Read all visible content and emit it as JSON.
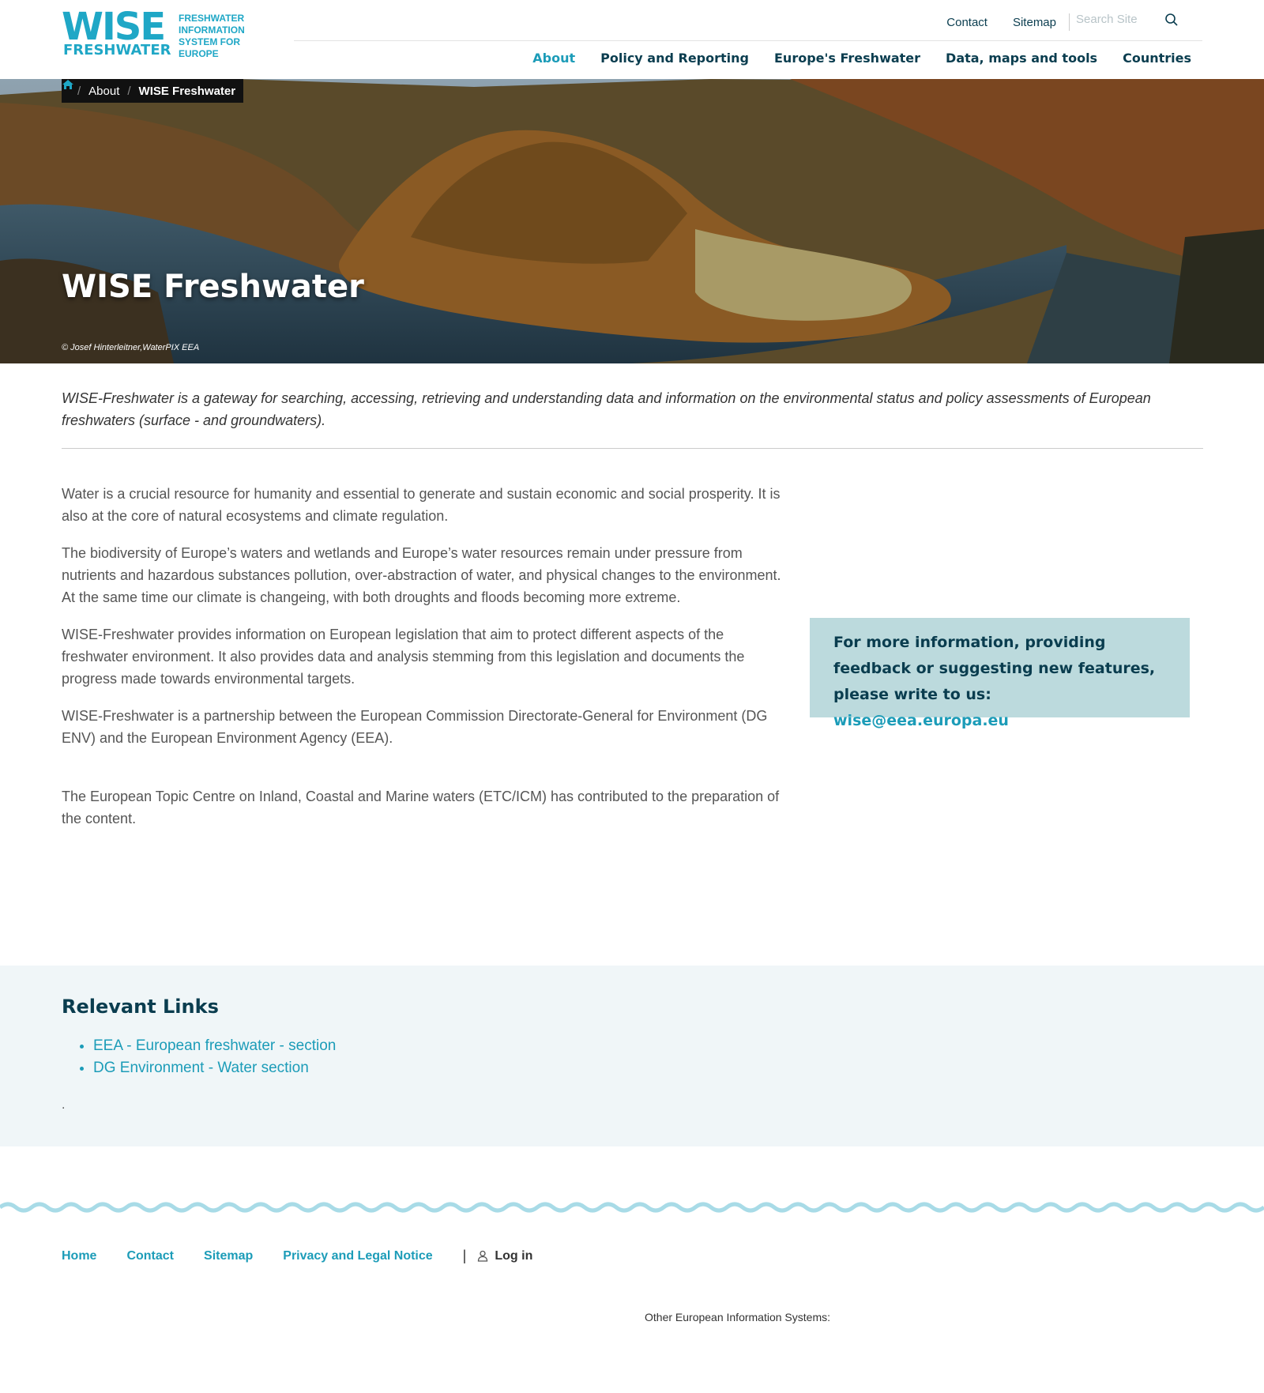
{
  "logo": {
    "wise": "WISE",
    "freshwater": "FRESHWATER",
    "tagline": [
      "FRESHWATER",
      "INFORMATION",
      "SYSTEM FOR",
      "EUROPE"
    ]
  },
  "top_links": {
    "contact": "Contact",
    "sitemap": "Sitemap"
  },
  "search": {
    "placeholder": "Search Site"
  },
  "main_nav": [
    {
      "label": "About",
      "active": true
    },
    {
      "label": "Policy and Reporting",
      "active": false
    },
    {
      "label": "Europe's Freshwater",
      "active": false
    },
    {
      "label": "Data, maps and tools",
      "active": false
    },
    {
      "label": "Countries",
      "active": false
    }
  ],
  "breadcrumb": {
    "about": "About",
    "current": "WISE Freshwater"
  },
  "hero": {
    "title": "WISE Freshwater",
    "credit": "© Josef Hinterleitner,WaterPIX EEA"
  },
  "lead": "WISE-Freshwater is a gateway for searching, accessing, retrieving and understanding data and information on the environmental status and policy assessments of European freshwaters (surface - and groundwaters).",
  "body": [
    "Water is a crucial resource for humanity and essential to generate and sustain economic and social prosperity. It is also at the core of natural ecosystems and climate regulation.",
    "The biodiversity of Europe’s waters and wetlands and Europe’s water resources remain under pressure from nutrients and hazardous substances pollution, over-abstraction of water, and physical changes to the environment. At the same time our climate is changeing, with both droughts and floods becoming more extreme.",
    "WISE-Freshwater provides information on European legislation that aim to protect different aspects of the freshwater environment. It also provides data and analysis stemming from this legislation and documents the progress made towards environmental targets.",
    "WISE-Freshwater is a partnership between the European Commission Directorate-General for Environment (DG ENV) and the European Environment Agency (EEA).",
    "The European Topic Centre on Inland, Coastal and Marine waters (ETC/ICM) has contributed to the preparation of the content."
  ],
  "info_box": {
    "text": "For more information, providing feedback or suggesting new features, please write to us:",
    "email": "wise@eea.europa.eu"
  },
  "relevant_links": {
    "title": "Relevant Links",
    "items": [
      "EEA - European freshwater - section",
      "DG Environment - Water section"
    ],
    "trailing": "."
  },
  "footer": {
    "links": [
      "Home",
      "Contact",
      "Sitemap",
      "Privacy and Legal Notice"
    ],
    "separator": "|",
    "login": "Log in",
    "other_systems": "Other European Information Systems:"
  },
  "colors": {
    "brand": "#1fa7c6",
    "nav_dark": "#0a3d4f",
    "accent": "#1c9cb8",
    "info_box_bg": "#bcdadd",
    "links_bg": "#f0f6f8"
  }
}
